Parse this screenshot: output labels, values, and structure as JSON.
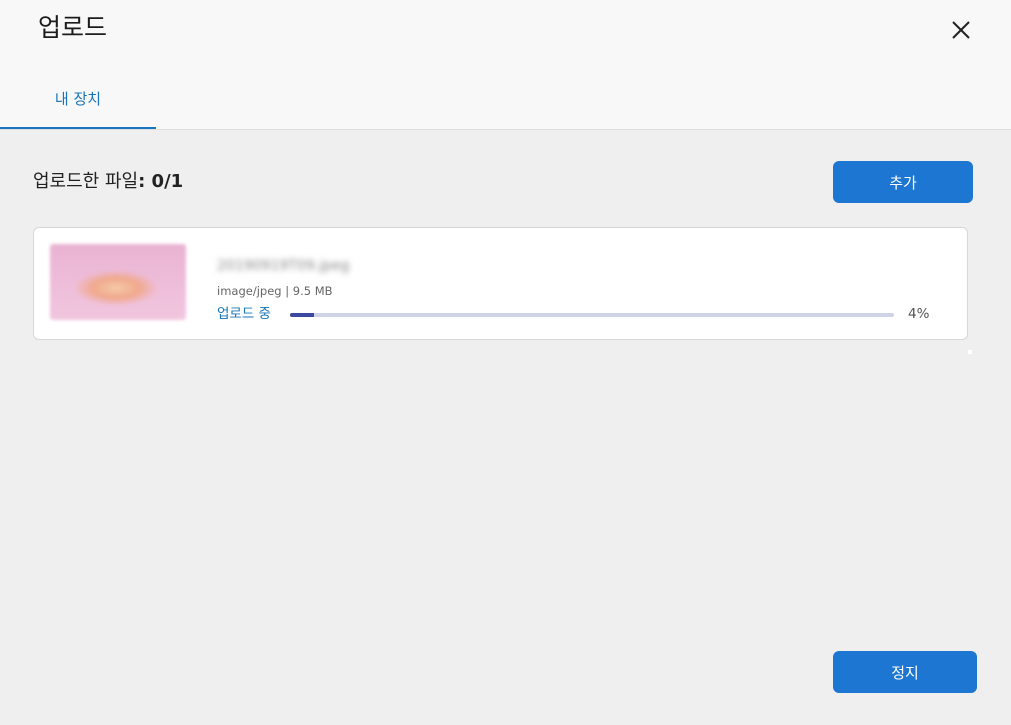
{
  "dialog": {
    "title": "업로드",
    "close_icon": "close-icon"
  },
  "tabs": [
    {
      "label": "내 장치",
      "active": true
    }
  ],
  "summary": {
    "label": "업로드한 파일",
    "count": ": 0/1"
  },
  "buttons": {
    "add_label": "추가",
    "stop_label": "정지"
  },
  "file": {
    "name": "20190919T09.jpeg",
    "meta": "image/jpeg | 9.5 MB",
    "status": "업로드 중",
    "progress_percent": 4,
    "percent_text": "4%"
  },
  "colors": {
    "accent": "#1d77d2",
    "tab_underline": "#1a73bd",
    "progress_fill": "#3b4aa0",
    "progress_track": "#cfd3e6"
  }
}
